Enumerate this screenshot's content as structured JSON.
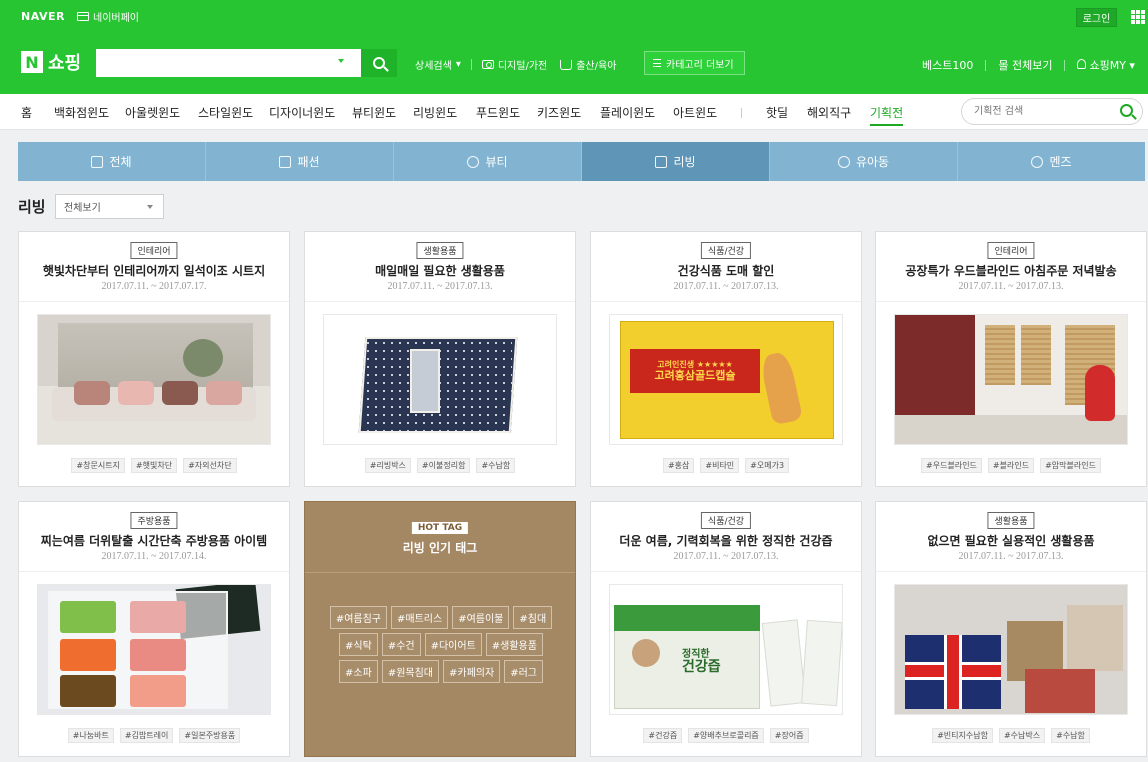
{
  "header": {
    "naver_logo": "NAVER",
    "npay_label": "네이버페이",
    "login_label": "로그인",
    "n_logo": "N",
    "shop_title": "쇼핑",
    "search_value": "",
    "detail_search": "상세검색",
    "links": [
      "디지털/가전",
      "출산/육아"
    ],
    "category_more": "카테고리 더보기",
    "right_links": [
      "베스트100",
      "몰 전체보기",
      "쇼핑MY"
    ]
  },
  "catnav": {
    "items": [
      "홈",
      "백화점윈도",
      "아울렛윈도",
      "스타일윈도",
      "디자이너윈도",
      "뷰티윈도",
      "리빙윈도",
      "푸드윈도",
      "키즈윈도",
      "플레이윈도",
      "아트윈도",
      "핫딜",
      "해외직구",
      "기획전"
    ],
    "search_placeholder": "기획전 검색"
  },
  "tabs": [
    "전체",
    "패션",
    "뷰티",
    "리빙",
    "유아동",
    "멘즈"
  ],
  "section": {
    "title": "리빙",
    "filter": "전체보기"
  },
  "cards": [
    {
      "badge": "인테리어",
      "title": "햇빛차단부터 인테리어까지 일석이조 시트지",
      "date": "2017.07.11. ~ 2017.07.17.",
      "tags": [
        "#창문시트지",
        "#햇빛차단",
        "#자외선차단"
      ]
    },
    {
      "badge": "생활용품",
      "title": "매일매일 필요한 생활용품",
      "date": "2017.07.11. ~ 2017.07.13.",
      "tags": [
        "#리빙박스",
        "#이불정리함",
        "#수납함"
      ]
    },
    {
      "badge": "식품/건강",
      "title": "건강식품 도매 할인",
      "date": "2017.07.11. ~ 2017.07.13.",
      "tags": [
        "#홍삼",
        "#비타민",
        "#오메가3"
      ]
    },
    {
      "badge": "인테리어",
      "title": "공장특가 우드블라인드 아침주문 저녁발송",
      "date": "2017.07.11. ~ 2017.07.13.",
      "tags": [
        "#우드블라인드",
        "#블라인드",
        "#암막블라인드"
      ]
    },
    {
      "badge": "주방용품",
      "title": "찌는여름 더위탈출 시간단축 주방용품 아이템",
      "date": "2017.07.11. ~ 2017.07.14.",
      "tags": [
        "#나눔바트",
        "#김밥트레이",
        "#일본주방용품"
      ]
    },
    {
      "badge": "식품/건강",
      "title": "더운 여름, 기력회복을 위한 정직한 건강즙",
      "date": "2017.07.11. ~ 2017.07.13.",
      "tags": [
        "#건강즙",
        "#양배추브로콜리즙",
        "#장어즙"
      ]
    },
    {
      "badge": "생활용품",
      "title": "없으면 필요한 실용적인 생활용품",
      "date": "2017.07.11. ~ 2017.07.13.",
      "tags": [
        "#빈티지수납함",
        "#수납박스",
        "#수납함"
      ]
    }
  ],
  "hot_tag": {
    "badge": "HOT TAG",
    "title": "리빙 인기 태그",
    "tags": [
      "#여름침구",
      "#매트리스",
      "#여름이불",
      "#침대",
      "#식탁",
      "#수건",
      "#다이어트",
      "#생활용품",
      "#소파",
      "#원목침대",
      "#카페의자",
      "#러그"
    ]
  },
  "product_labels": {
    "ginseng_line1": "고려인진생 ★★★★★",
    "ginseng_line2": "고려홍삼골드캡슐",
    "juice_line1": "정직한",
    "juice_line2": "건강즙"
  },
  "icons": {
    "tabs": [
      "list-icon",
      "hanger-icon",
      "mirror-icon",
      "house-icon",
      "baby-icon",
      "men-icon"
    ]
  },
  "colors": {
    "brand_green": "#27c532",
    "tab_bg": "#82b4d2",
    "tab_active": "#5f95b6",
    "hot_tag_bg": "#a48763"
  }
}
